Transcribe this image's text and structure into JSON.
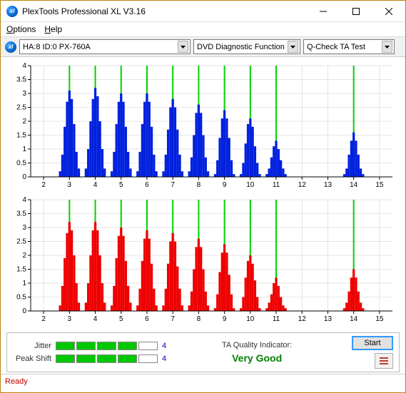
{
  "window": {
    "title": "PlexTools Professional XL V3.16"
  },
  "menu": {
    "options": "Options",
    "help": "Help"
  },
  "toolbar": {
    "device": "HA:8 ID:0  PX-760A",
    "function": "DVD Diagnostic Functions",
    "test": "Q-Check TA Test"
  },
  "chart_data": [
    {
      "type": "bar",
      "color": "#0020dd",
      "xticks": [
        2,
        3,
        4,
        5,
        6,
        7,
        8,
        9,
        10,
        11,
        12,
        13,
        14,
        15
      ],
      "yticks": [
        0,
        0.5,
        1,
        1.5,
        2,
        2.5,
        3,
        3.5,
        4
      ],
      "markers": [
        3,
        4,
        5,
        6,
        7,
        8,
        9,
        10,
        11,
        14
      ],
      "xlim": [
        1.5,
        15.5
      ],
      "ylim": [
        0,
        4
      ],
      "series": [
        {
          "center": 3,
          "values": [
            0.2,
            0.8,
            1.8,
            2.7,
            3.1,
            2.8,
            1.9,
            0.9,
            0.3
          ]
        },
        {
          "center": 4,
          "values": [
            0.3,
            1.0,
            2.0,
            2.8,
            3.2,
            2.9,
            2.0,
            1.0,
            0.3
          ]
        },
        {
          "center": 5,
          "values": [
            0.2,
            0.9,
            1.9,
            2.7,
            3.0,
            2.7,
            1.8,
            0.9,
            0.3
          ]
        },
        {
          "center": 6,
          "values": [
            0.2,
            0.9,
            1.9,
            2.7,
            3.0,
            2.7,
            1.8,
            0.8,
            0.2
          ]
        },
        {
          "center": 7,
          "values": [
            0.2,
            0.8,
            1.7,
            2.5,
            2.8,
            2.5,
            1.7,
            0.8,
            0.2
          ]
        },
        {
          "center": 8,
          "values": [
            0.2,
            0.7,
            1.5,
            2.3,
            2.6,
            2.3,
            1.5,
            0.7,
            0.2
          ]
        },
        {
          "center": 9,
          "values": [
            0.1,
            0.6,
            1.4,
            2.1,
            2.4,
            2.1,
            1.4,
            0.6,
            0.1
          ]
        },
        {
          "center": 10,
          "values": [
            0.1,
            0.5,
            1.2,
            1.9,
            2.1,
            1.8,
            1.1,
            0.5,
            0.1
          ]
        },
        {
          "center": 11,
          "values": [
            0.1,
            0.3,
            0.7,
            1.1,
            1.3,
            1.0,
            0.6,
            0.3,
            0.1
          ]
        },
        {
          "center": 14,
          "values": [
            0.1,
            0.3,
            0.8,
            1.3,
            1.6,
            1.3,
            0.8,
            0.3,
            0.1
          ]
        }
      ]
    },
    {
      "type": "bar",
      "color": "#ee0000",
      "xticks": [
        2,
        3,
        4,
        5,
        6,
        7,
        8,
        9,
        10,
        11,
        12,
        13,
        14,
        15
      ],
      "yticks": [
        0,
        0.5,
        1,
        1.5,
        2,
        2.5,
        3,
        3.5,
        4
      ],
      "markers": [
        3,
        4,
        5,
        6,
        7,
        8,
        9,
        10,
        11,
        14
      ],
      "xlim": [
        1.5,
        15.5
      ],
      "ylim": [
        0,
        4
      ],
      "series": [
        {
          "center": 3,
          "values": [
            0.2,
            0.9,
            1.9,
            2.8,
            3.2,
            2.9,
            2.0,
            1.0,
            0.3
          ]
        },
        {
          "center": 4,
          "values": [
            0.3,
            1.0,
            2.0,
            2.9,
            3.2,
            2.9,
            2.0,
            1.0,
            0.3
          ]
        },
        {
          "center": 5,
          "values": [
            0.2,
            0.9,
            1.9,
            2.7,
            3.0,
            2.7,
            1.8,
            0.9,
            0.3
          ]
        },
        {
          "center": 6,
          "values": [
            0.2,
            0.8,
            1.8,
            2.6,
            2.9,
            2.6,
            1.7,
            0.8,
            0.2
          ]
        },
        {
          "center": 7,
          "values": [
            0.2,
            0.8,
            1.7,
            2.5,
            2.8,
            2.5,
            1.6,
            0.8,
            0.2
          ]
        },
        {
          "center": 8,
          "values": [
            0.2,
            0.7,
            1.5,
            2.3,
            2.6,
            2.3,
            1.5,
            0.7,
            0.2
          ]
        },
        {
          "center": 9,
          "values": [
            0.1,
            0.6,
            1.4,
            2.1,
            2.4,
            2.1,
            1.3,
            0.6,
            0.1
          ]
        },
        {
          "center": 10,
          "values": [
            0.1,
            0.5,
            1.2,
            1.8,
            2.0,
            1.7,
            1.1,
            0.5,
            0.1
          ]
        },
        {
          "center": 11,
          "values": [
            0.1,
            0.3,
            0.6,
            1.0,
            1.2,
            0.9,
            0.5,
            0.2,
            0.1
          ]
        },
        {
          "center": 14,
          "values": [
            0.1,
            0.3,
            0.7,
            1.2,
            1.5,
            1.2,
            0.7,
            0.3,
            0.1
          ]
        }
      ]
    }
  ],
  "metrics": {
    "jitter": {
      "label": "Jitter",
      "value": "4",
      "filled": 4,
      "total": 5
    },
    "peak_shift": {
      "label": "Peak Shift",
      "value": "4",
      "filled": 4,
      "total": 5
    }
  },
  "quality": {
    "label": "TA Quality Indicator:",
    "value": "Very Good"
  },
  "buttons": {
    "start": "Start"
  },
  "status": {
    "text": "Ready"
  }
}
